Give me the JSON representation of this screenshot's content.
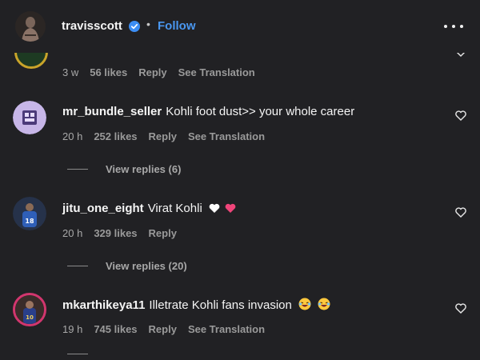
{
  "header": {
    "username": "travisscott",
    "separator": "•",
    "follow_label": "Follow",
    "verified_icon": "verified-badge-icon",
    "more_icon": "more-options-icon"
  },
  "comments": [
    {
      "user": "",
      "text": "",
      "time": "3 w",
      "likes": "56 likes",
      "reply": "Reply",
      "translate": "See Translation"
    },
    {
      "user": "mr_bundle_seller",
      "text": "Kohli foot dust>> your whole career",
      "time": "20 h",
      "likes": "252 likes",
      "reply": "Reply",
      "translate": "See Translation",
      "view_replies": "View replies (6)"
    },
    {
      "user": "jitu_one_eight",
      "text": "Virat Kohli",
      "emojis": [
        "white-heart-icon",
        "pink-heart-icon"
      ],
      "time": "20 h",
      "likes": "329 likes",
      "reply": "Reply",
      "view_replies": "View replies (20)"
    },
    {
      "user": "mkarthikeya11",
      "text": "Illetrate Kohli fans invasion",
      "emojis": [
        "laughing-face-icon",
        "laughing-face-icon"
      ],
      "time": "19 h",
      "likes": "745 likes",
      "reply": "Reply",
      "translate": "See Translation"
    }
  ],
  "colors": {
    "background": "#212124",
    "follow": "#4a97f0",
    "meta": "#a8a8a8"
  }
}
